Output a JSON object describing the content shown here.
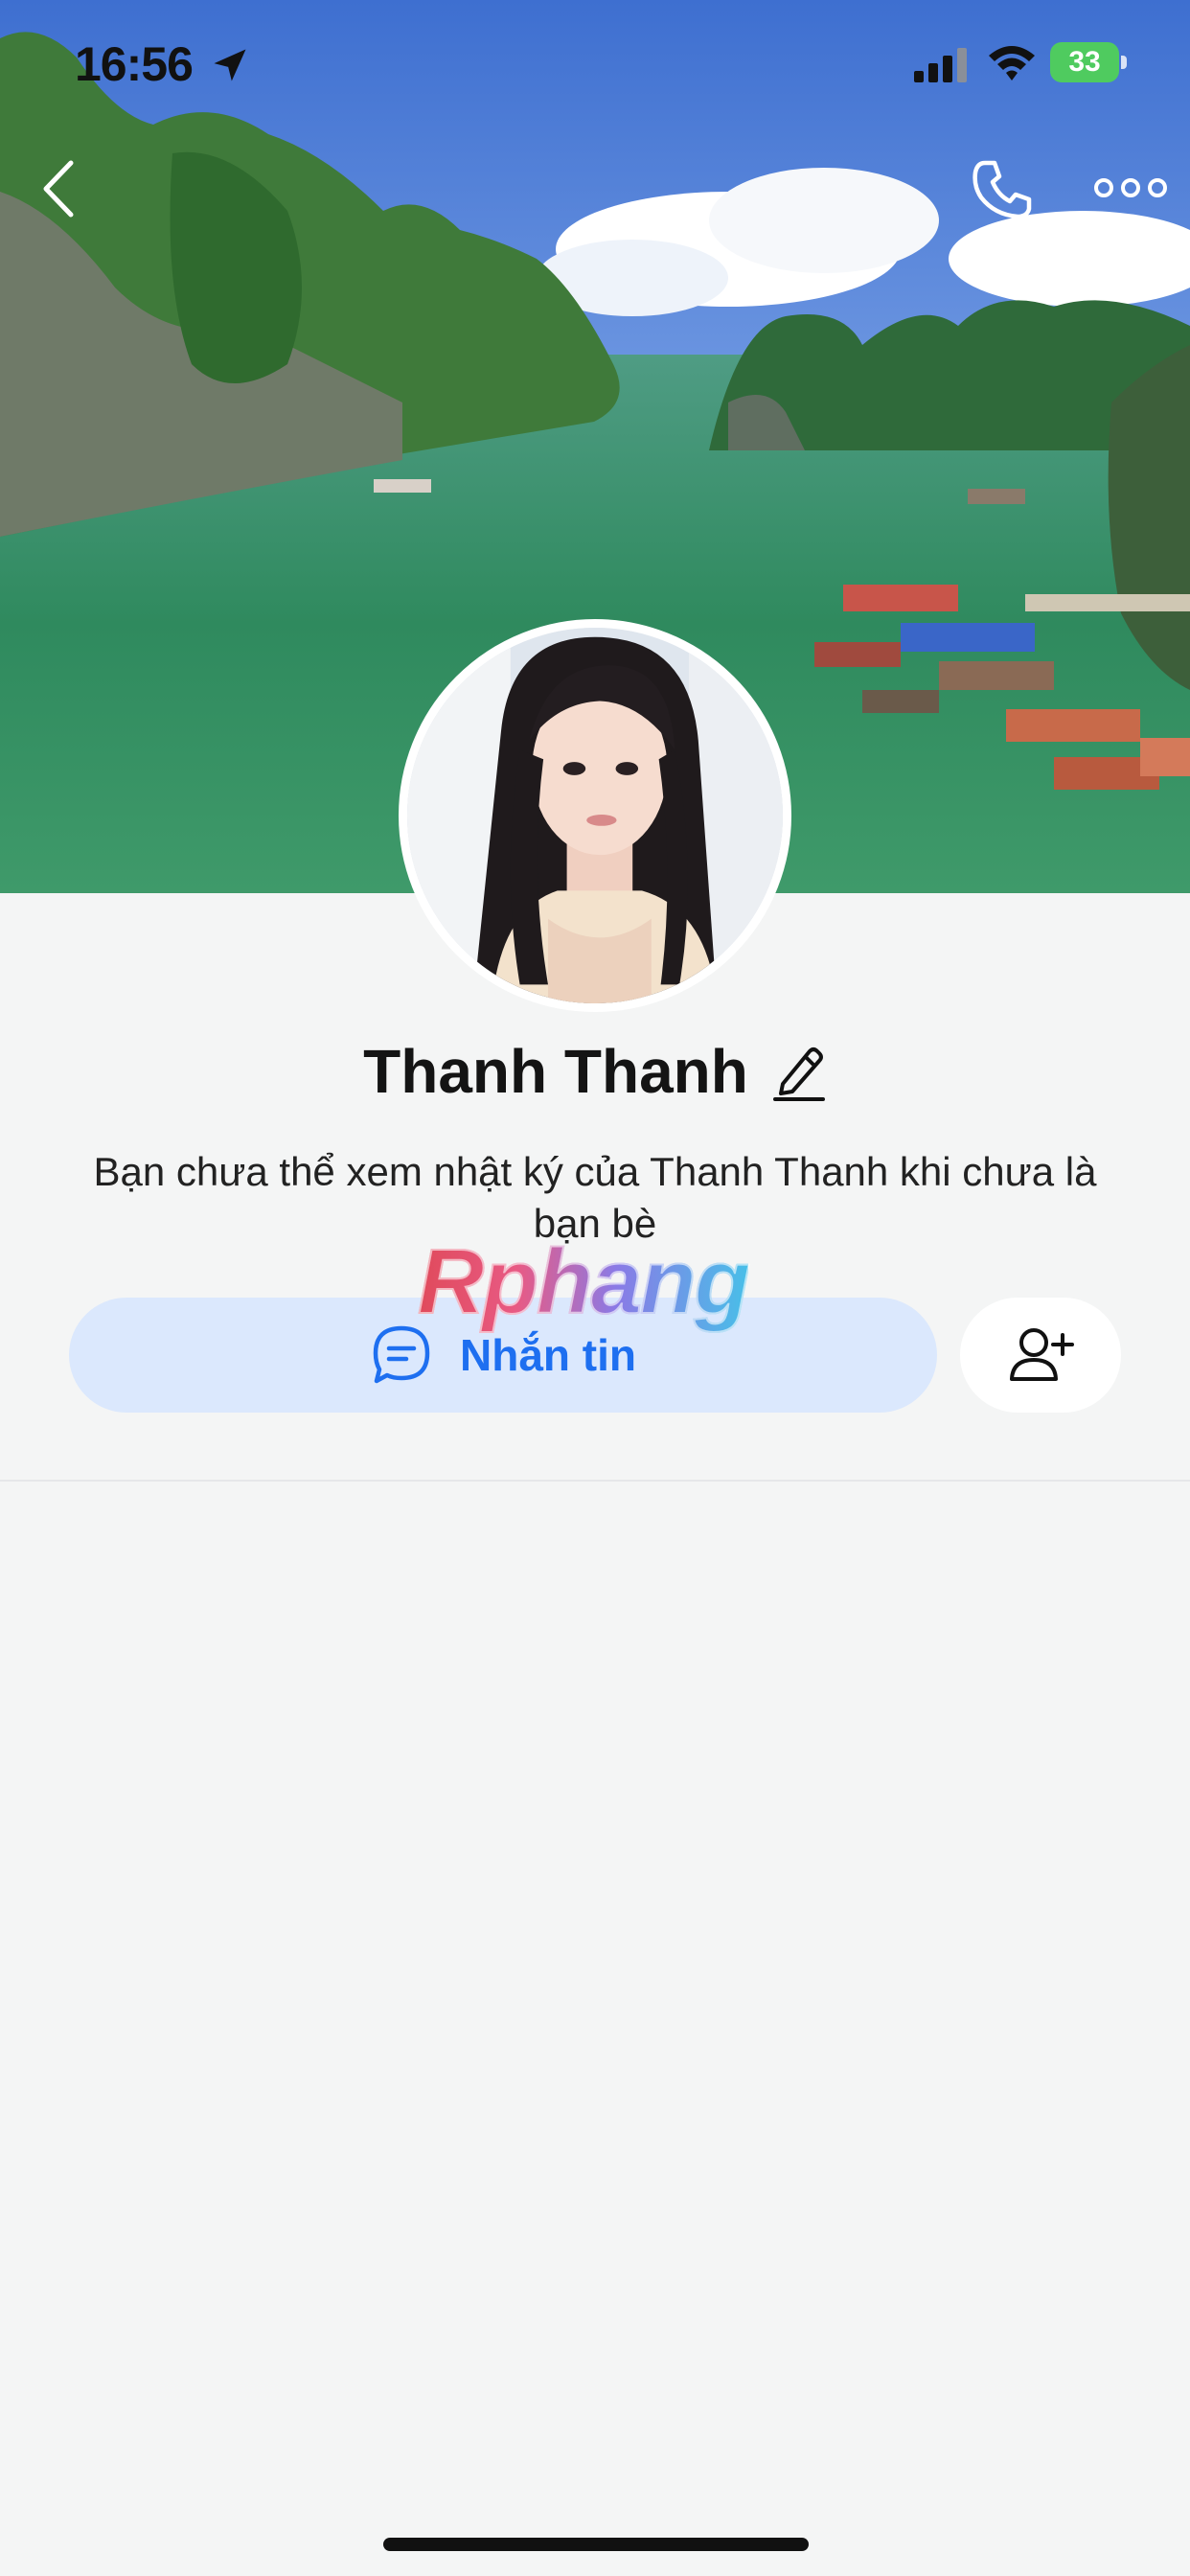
{
  "status_bar": {
    "time": "16:56",
    "battery": "33"
  },
  "icons": {
    "back": "chevron-left-icon",
    "call": "phone-icon",
    "more": "more-dots-icon",
    "edit": "pencil-icon",
    "message": "chat-bubble-icon",
    "add_friend": "add-user-icon",
    "location": "location-arrow-icon"
  },
  "profile": {
    "name": "Thanh Thanh",
    "notice": "Bạn chưa thể xem nhật ký của Thanh Thanh khi chưa là bạn bè"
  },
  "actions": {
    "message_label": "Nhắn tin"
  },
  "watermark": "Rphang",
  "colors": {
    "accent": "#1e6ff0",
    "message_button_bg": "#dbe8fd",
    "page_bg": "#f4f5f5",
    "battery": "#4fcb5f"
  }
}
